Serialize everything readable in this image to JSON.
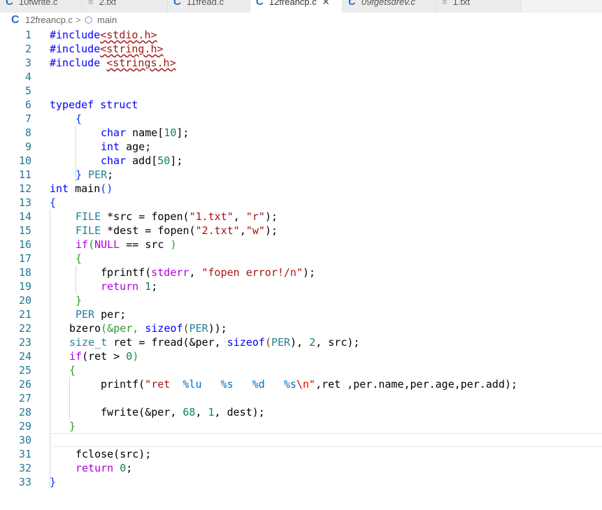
{
  "tabs": [
    {
      "label": "10fwrite.c",
      "icon": "c-file-icon",
      "active": false
    },
    {
      "label": "2.txt",
      "icon": "text-file-icon",
      "active": false
    },
    {
      "label": "11fread.c",
      "icon": "c-file-icon",
      "active": false
    },
    {
      "label": "12freancp.c",
      "icon": "c-file-icon",
      "active": true,
      "close": "✕"
    },
    {
      "label": "09fgetsdrev.c",
      "icon": "c-file-icon",
      "active": false
    },
    {
      "label": "1.txt",
      "icon": "text-file-icon",
      "active": false
    }
  ],
  "breadcrumb": {
    "file": "12freancp.c",
    "separator": ">",
    "symbol": "main"
  },
  "lines": [
    "1",
    "2",
    "3",
    "4",
    "5",
    "6",
    "7",
    "8",
    "9",
    "10",
    "11",
    "12",
    "13",
    "14",
    "15",
    "16",
    "17",
    "18",
    "19",
    "20",
    "21",
    "22",
    "23",
    "24",
    "25",
    "26",
    "27",
    "28",
    "29",
    "30",
    "31",
    "32",
    "33"
  ],
  "code": {
    "l1a": "#include",
    "l1b": "<stdio.h>",
    "l2a": "#include",
    "l2b": "<string.h>",
    "l3a": "#include ",
    "l3b": "<strings.h>",
    "l6": "typedef struct",
    "l7": "{",
    "l8a": "char",
    "l8b": " name[",
    "l8c": "10",
    "l8d": "];",
    "l9a": "int",
    "l9b": " age;",
    "l10a": "char",
    "l10b": " add[",
    "l10c": "50",
    "l10d": "];",
    "l11a": "}",
    "l11b": " PER",
    "l11c": ";",
    "l12a": "int",
    "l12b": " main",
    "l12c": "()",
    "l13": "{",
    "l14a": "FILE",
    "l14b": " *src = fopen(",
    "l14c": "\"1.txt\"",
    "l14d": ", ",
    "l14e": "\"r\"",
    "l14f": ");",
    "l15a": "FILE",
    "l15b": " *dest = fopen(",
    "l15c": "\"2.txt\"",
    "l15d": ",",
    "l15e": "\"w\"",
    "l15f": ");",
    "l16a": "if",
    "l16b": "(",
    "l16c": "NULL",
    "l16d": " == src ",
    "l16e": ")",
    "l17": "{",
    "l18a": "fprintf(",
    "l18b": "stderr",
    "l18c": ", ",
    "l18d": "\"fopen error!/n\"",
    "l18e": ");",
    "l19a": "return",
    "l19b": " ",
    "l19c": "1",
    "l19d": ";",
    "l20": "}",
    "l21a": "PER",
    "l21b": " per;",
    "l22a": "bzero",
    "l22b": "(&per, ",
    "l22c": "sizeof",
    "l22d": "(",
    "l22e": "PER",
    "l22f": "));",
    "l23a": "size_t",
    "l23b": " ret = fread(&per, ",
    "l23c": "sizeof",
    "l23d": "(",
    "l23e": "PER",
    "l23f": "), ",
    "l23g": "2",
    "l23h": ", src);",
    "l24a": "if",
    "l24b": "(ret > ",
    "l24c": "0",
    "l24d": ")",
    "l25": "{",
    "l26a": "printf(",
    "l26b": "\"ret  ",
    "l26c": "%lu",
    "l26d": "   ",
    "l26e": "%s",
    "l26f": "   ",
    "l26g": "%d",
    "l26h": "   ",
    "l26i": "%s",
    "l26j": "\\n",
    "l26k": "\"",
    "l26l": ",ret ,per.name,per.age,per.add);",
    "l28a": "fwrite(&per, ",
    "l28b": "68",
    "l28c": ", ",
    "l28d": "1",
    "l28e": ", dest);",
    "l29": "}",
    "l31": "fclose(src);",
    "l32a": "return",
    "l32b": " ",
    "l32c": "0",
    "l32d": ";",
    "l33": "}"
  }
}
